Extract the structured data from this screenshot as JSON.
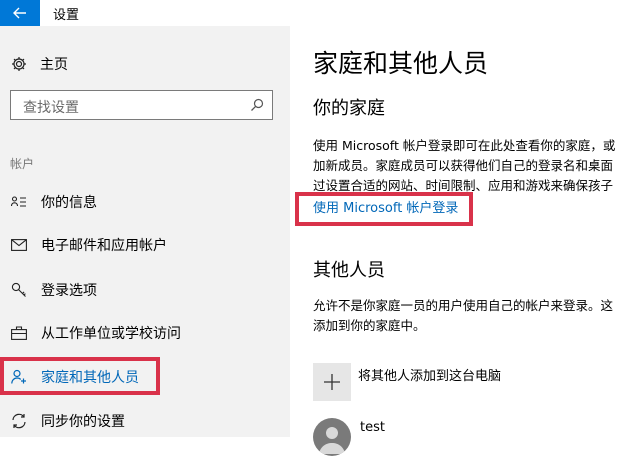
{
  "window": {
    "title": "设置",
    "back_icon": "arrow-left-icon",
    "accent": "#0078d7"
  },
  "sidebar": {
    "home": {
      "label": "主页",
      "icon": "gear-icon"
    },
    "search": {
      "placeholder": "查找设置",
      "icon": "search-icon"
    },
    "section": "帐户",
    "items": [
      {
        "label": "你的信息",
        "icon": "person-list-icon"
      },
      {
        "label": "电子邮件和应用帐户",
        "icon": "mail-icon"
      },
      {
        "label": "登录选项",
        "icon": "key-icon"
      },
      {
        "label": "从工作单位或学校访问",
        "icon": "briefcase-icon"
      },
      {
        "label": "家庭和其他人员",
        "icon": "person-add-icon",
        "selected": true
      },
      {
        "label": "同步你的设置",
        "icon": "sync-icon"
      }
    ]
  },
  "main": {
    "title": "家庭和其他人员",
    "family": {
      "heading": "你的家庭",
      "lines": [
        "使用 Microsoft 帐户登录即可在此处查看你的家庭，或",
        "加新成员。家庭成员可以获得他们自己的登录名和桌面",
        "过设置合适的网站、时间限制、应用和游戏来确保孩子"
      ],
      "link": "使用 Microsoft 帐户登录"
    },
    "others": {
      "heading": "其他人员",
      "lines": [
        "允许不是你家庭一员的用户使用自己的帐户来登录。这",
        "添加到你的家庭中。"
      ],
      "add_label": "将其他人添加到这台电脑",
      "user_name": "test"
    }
  },
  "highlight_color": "#d9324a"
}
